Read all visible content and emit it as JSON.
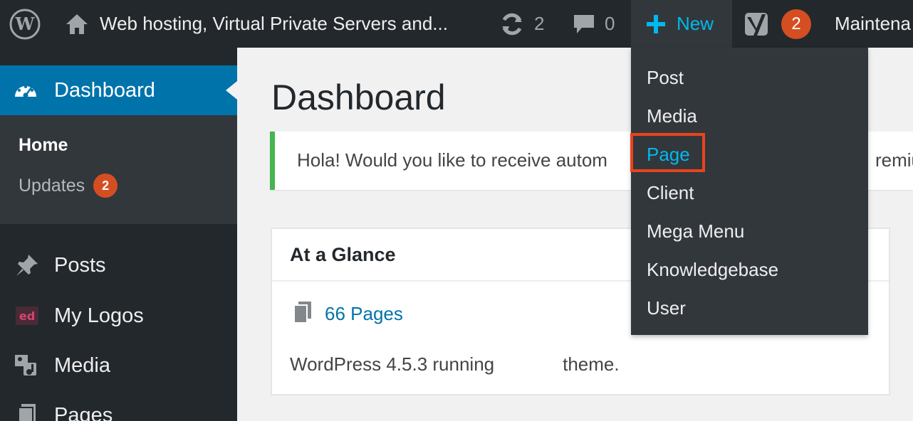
{
  "admin_bar": {
    "site_name": "Web hosting, Virtual Private Servers and...",
    "updates_count": "2",
    "comments_count": "0",
    "new_label": "New",
    "yoast_count": "2",
    "maintenance_label": "Maintena"
  },
  "sidebar": {
    "active_menu": "Dashboard",
    "submenu": [
      {
        "label": "Home"
      },
      {
        "label": "Updates",
        "badge": "2"
      }
    ],
    "items": [
      {
        "label": "Posts",
        "icon": "pin-icon"
      },
      {
        "label": "My Logos",
        "icon": "ed-logo-icon"
      },
      {
        "label": "Media",
        "icon": "media-icon"
      },
      {
        "label": "Pages",
        "icon": "pages-icon"
      }
    ]
  },
  "main": {
    "title": "Dashboard",
    "notice_text": "Hola! Would you like to receive autom",
    "notice_text_right": "remiu",
    "glance": {
      "title": "At a Glance",
      "pages_link": "66 Pages",
      "wp_text_before": "WordPress 4.5.3 running",
      "wp_text_after": "theme."
    }
  },
  "new_dropdown": {
    "items": [
      "Post",
      "Media",
      "Page",
      "Client",
      "Mega Menu",
      "Knowledgebase",
      "User"
    ],
    "highlighted": "Page"
  },
  "colors": {
    "admin_bar": "#23282d",
    "accent_blue": "#0073aa",
    "link_cyan": "#00b9eb",
    "badge_orange": "#d54e21",
    "notice_green": "#46b450",
    "highlight_red": "#e8441d"
  }
}
